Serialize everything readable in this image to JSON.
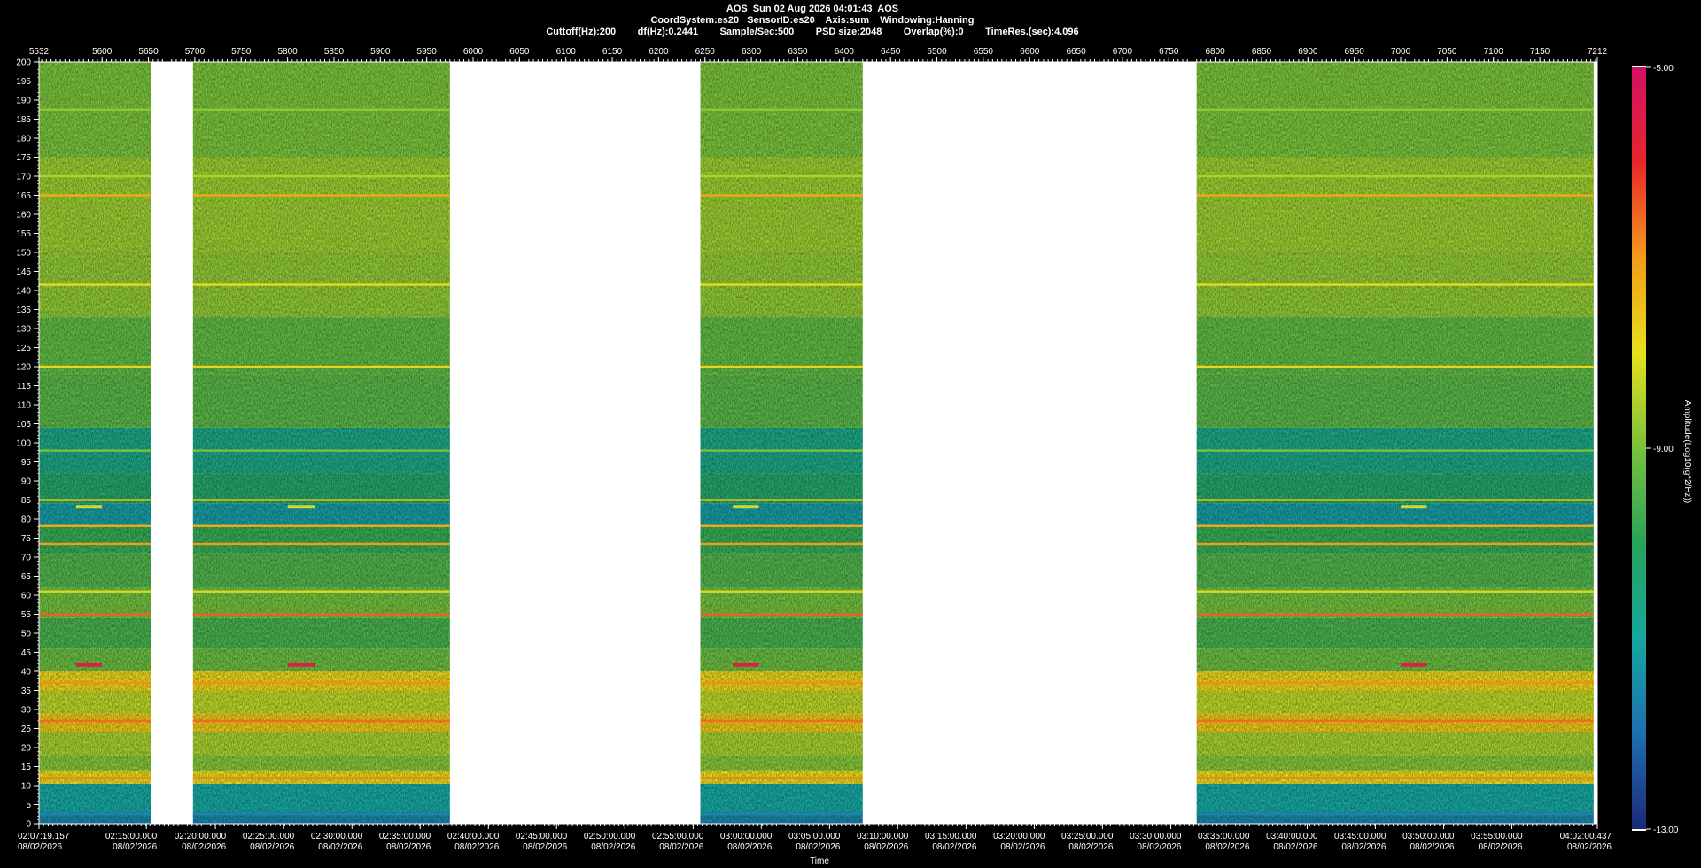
{
  "header": {
    "line1": "AOS  Sun 02 Aug 2026 04:01:43  AOS",
    "line2": "CoordSystem:es20   SensorID:es20    Axis:sum    Windowing:Hanning",
    "line3": "Cuttoff(Hz):200        df(Hz):0.2441        Sample/Sec:500        PSD size:2048        Overlap(%):0        TimeRes.(sec):4.096"
  },
  "colors": {
    "background": "#000000",
    "gap": "#ffffff",
    "colormap": [
      "#1b2a7a",
      "#1d6fb0",
      "#17a6a0",
      "#27a35a",
      "#79c13b",
      "#e6e11b",
      "#f39b1a",
      "#e8262a",
      "#d40f66"
    ]
  },
  "chart_data": {
    "type": "heatmap",
    "title": "",
    "xlabel": "Time",
    "ylabel": "",
    "top_axis": {
      "range": [
        5532,
        7212
      ],
      "ticks": [
        5532,
        5600,
        5650,
        5700,
        5750,
        5800,
        5850,
        5900,
        5950,
        6000,
        6050,
        6100,
        6150,
        6200,
        6250,
        6300,
        6350,
        6400,
        6450,
        6500,
        6550,
        6600,
        6650,
        6700,
        6750,
        6800,
        6850,
        6900,
        6950,
        7000,
        7050,
        7100,
        7150,
        7212
      ]
    },
    "y_axis": {
      "range": [
        0,
        200
      ],
      "ticks": [
        0,
        5,
        10,
        15,
        20,
        25,
        30,
        35,
        40,
        45,
        50,
        55,
        60,
        65,
        70,
        75,
        80,
        85,
        90,
        95,
        100,
        105,
        110,
        115,
        120,
        125,
        130,
        135,
        140,
        145,
        150,
        155,
        160,
        165,
        170,
        175,
        180,
        185,
        190,
        195,
        200
      ]
    },
    "x_time_labels": [
      {
        "t": "02:07:19.157",
        "d": "08/02/2026",
        "s": 5532
      },
      {
        "t": "02:15:00.000",
        "d": "08/02/2026",
        "s": 5647.8
      },
      {
        "t": "02:20:00.000",
        "d": "08/02/2026",
        "s": 5722.2
      },
      {
        "t": "02:25:00.000",
        "d": "08/02/2026",
        "s": 5795.8
      },
      {
        "t": "02:30:00.000",
        "d": "08/02/2026",
        "s": 5869.4
      },
      {
        "t": "02:35:00.000",
        "d": "08/02/2026",
        "s": 5942.9
      },
      {
        "t": "02:40:00.000",
        "d": "08/02/2026",
        "s": 6016.5
      },
      {
        "t": "02:45:00.000",
        "d": "08/02/2026",
        "s": 6090.0
      },
      {
        "t": "02:50:00.000",
        "d": "08/02/2026",
        "s": 6163.6
      },
      {
        "t": "02:55:00.000",
        "d": "08/02/2026",
        "s": 6237.2
      },
      {
        "t": "03:00:00.000",
        "d": "08/02/2026",
        "s": 6310.7
      },
      {
        "t": "03:05:00.000",
        "d": "08/02/2026",
        "s": 6384.3
      },
      {
        "t": "03:10:00.000",
        "d": "08/02/2026",
        "s": 6457.8
      },
      {
        "t": "03:15:00.000",
        "d": "08/02/2026",
        "s": 6531.4
      },
      {
        "t": "03:20:00.000",
        "d": "08/02/2026",
        "s": 6605.0
      },
      {
        "t": "03:25:00.000",
        "d": "08/02/2026",
        "s": 6678.5
      },
      {
        "t": "03:30:00.000",
        "d": "08/02/2026",
        "s": 6752.1
      },
      {
        "t": "03:35:00.000",
        "d": "08/02/2026",
        "s": 6825.6
      },
      {
        "t": "03:40:00.000",
        "d": "08/02/2026",
        "s": 6899.2
      },
      {
        "t": "03:45:00.000",
        "d": "08/02/2026",
        "s": 6972.7
      },
      {
        "t": "03:50:00.000",
        "d": "08/02/2026",
        "s": 7046.3
      },
      {
        "t": "03:55:00.000",
        "d": "08/02/2026",
        "s": 7119.9
      },
      {
        "t": "04:02:00.437",
        "d": "08/02/2026",
        "s": 7212
      }
    ],
    "data_segments": [
      [
        5532,
        5653
      ],
      [
        5698,
        5975
      ],
      [
        6245,
        6420
      ],
      [
        6780,
        7208
      ]
    ],
    "gaps": [
      [
        5653,
        5698
      ],
      [
        5975,
        6245
      ],
      [
        6420,
        6780
      ]
    ],
    "colorbar": {
      "label": "Amplitude(Log10(g^2/Hz))",
      "range": [
        -13,
        -5
      ],
      "tick_labels": [
        "-5.00",
        "-9.00",
        "-13.00"
      ],
      "tick_values": [
        -5,
        -9,
        -13
      ]
    },
    "bands": [
      {
        "f0": 0,
        "f1": 3,
        "v": -11.6
      },
      {
        "f0": 3,
        "f1": 10.5,
        "v": -11.0
      },
      {
        "f0": 10.5,
        "f1": 14,
        "v": -7.9
      },
      {
        "f0": 14,
        "f1": 18,
        "v": -8.9
      },
      {
        "f0": 18,
        "f1": 24,
        "v": -8.6
      },
      {
        "f0": 24,
        "f1": 29,
        "v": -7.6
      },
      {
        "f0": 29,
        "f1": 35,
        "v": -8.4
      },
      {
        "f0": 35,
        "f1": 40,
        "v": -7.8
      },
      {
        "f0": 40,
        "f1": 46,
        "v": -9.2
      },
      {
        "f0": 46,
        "f1": 54,
        "v": -9.6
      },
      {
        "f0": 54,
        "f1": 62,
        "v": -9.1
      },
      {
        "f0": 62,
        "f1": 71,
        "v": -9.5
      },
      {
        "f0": 71,
        "f1": 78,
        "v": -9.8
      },
      {
        "f0": 78,
        "f1": 84,
        "v": -11.2
      },
      {
        "f0": 84,
        "f1": 92,
        "v": -10.2
      },
      {
        "f0": 92,
        "f1": 104,
        "v": -10.6
      },
      {
        "f0": 104,
        "f1": 118,
        "v": -9.4
      },
      {
        "f0": 118,
        "f1": 133,
        "v": -9.3
      },
      {
        "f0": 133,
        "f1": 150,
        "v": -8.8
      },
      {
        "f0": 150,
        "f1": 175,
        "v": -8.7
      },
      {
        "f0": 175,
        "f1": 200,
        "v": -9.0
      }
    ],
    "lines": [
      {
        "f": 2.5,
        "v": -11.6
      },
      {
        "f": 12,
        "v": -6.8
      },
      {
        "f": 27,
        "v": -6.6
      },
      {
        "f": 37,
        "v": -6.9
      },
      {
        "f": 55,
        "v": -6.5
      },
      {
        "f": 61,
        "v": -8.2
      },
      {
        "f": 73.5,
        "v": -7.0
      },
      {
        "f": 78.2,
        "v": -7.2
      },
      {
        "f": 85,
        "v": -7.6
      },
      {
        "f": 98,
        "v": -9.0
      },
      {
        "f": 120,
        "v": -7.8
      },
      {
        "f": 141.5,
        "v": -7.9
      },
      {
        "f": 165,
        "v": -7.2
      },
      {
        "f": 170,
        "v": -8.5
      },
      {
        "f": 187.5,
        "v": -8.8
      }
    ],
    "events": [
      {
        "s0": 5572,
        "s1": 5600,
        "f": 41.7,
        "v": -5.6
      },
      {
        "s0": 5572,
        "s1": 5600,
        "f": 83.2,
        "v": -8.2
      },
      {
        "s0": 5800,
        "s1": 5830,
        "f": 41.7,
        "v": -5.6
      },
      {
        "s0": 5800,
        "s1": 5830,
        "f": 83.2,
        "v": -8.2
      },
      {
        "s0": 6280,
        "s1": 6308,
        "f": 41.7,
        "v": -5.6
      },
      {
        "s0": 6280,
        "s1": 6308,
        "f": 83.2,
        "v": -8.2
      },
      {
        "s0": 7000,
        "s1": 7028,
        "f": 41.7,
        "v": -5.6
      },
      {
        "s0": 7000,
        "s1": 7028,
        "f": 83.2,
        "v": -8.2
      }
    ]
  }
}
